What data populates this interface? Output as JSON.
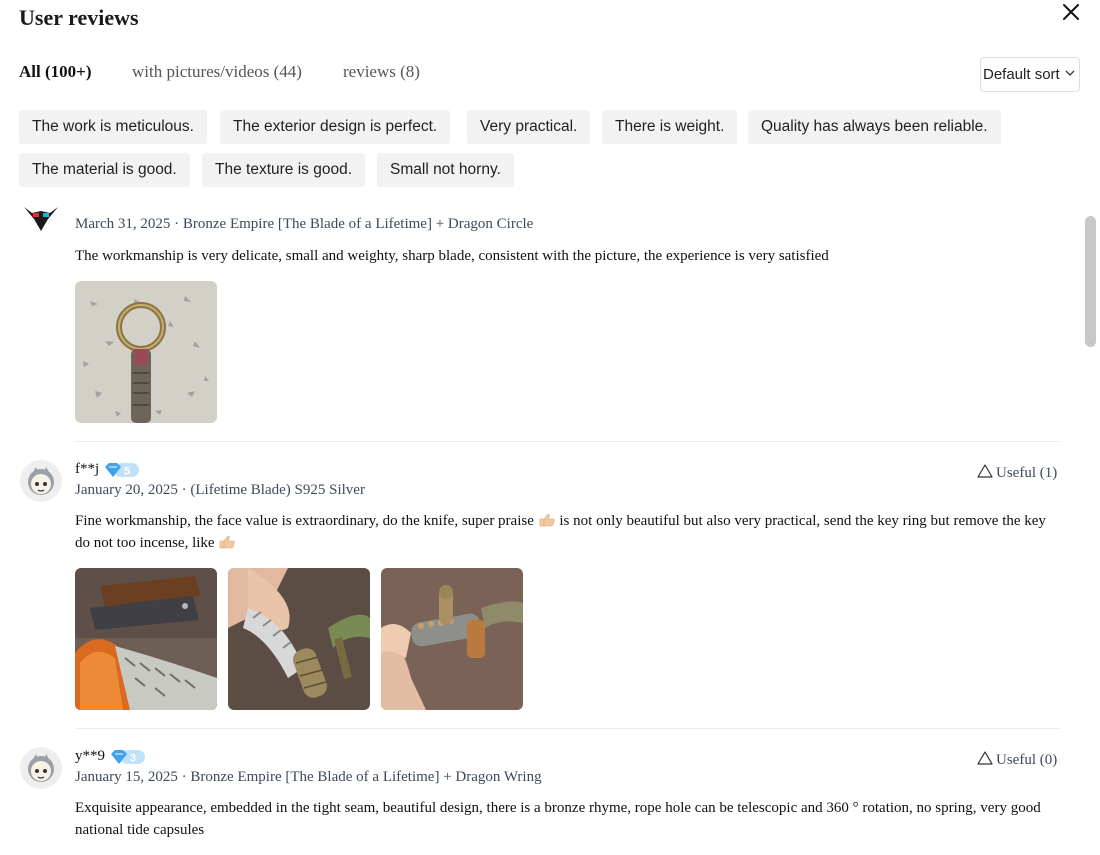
{
  "header": {
    "title": "User reviews"
  },
  "tabs": [
    {
      "label": "All (100+)"
    },
    {
      "label": "with pictures/videos (44)"
    },
    {
      "label": "reviews (8)"
    }
  ],
  "sort": {
    "label": "Default sort"
  },
  "tags": [
    "The work is meticulous.",
    "The exterior design is perfect.",
    "Very practical.",
    "There is weight.",
    "Quality has always been reliable.",
    "The material is good.",
    "The texture is good.",
    "Small not horny."
  ],
  "reviews": [
    {
      "meta": "March 31, 2025 · Bronze Empire [The Blade of a Lifetime] + Dragon Circle",
      "text": "The workmanship is very delicate, small and weighty, sharp blade, consistent with the picture, the experience is very satisfied"
    },
    {
      "user": "f**j",
      "level": "5",
      "meta": "January 20, 2025 · (Lifetime Blade) S925 Silver",
      "text_a": "Fine workmanship, the face value is extraordinary, do the knife, super praise",
      "text_b": "is not only beautiful but also very practical, send the key ring but remove the key",
      "text_c": "do not too incense, like",
      "useful": "Useful (1)"
    },
    {
      "user": "y**9",
      "level": "3",
      "meta": "January 15, 2025 · Bronze Empire [The Blade of a Lifetime] + Dragon Wring",
      "text_a": "Exquisite appearance, embedded in the tight seam, beautiful design, there is a bronze rhyme, rope hole can be telescopic and 360 ° rotation, no spring, very good",
      "text_b": "national tide capsules",
      "useful": "Useful (0)"
    }
  ]
}
